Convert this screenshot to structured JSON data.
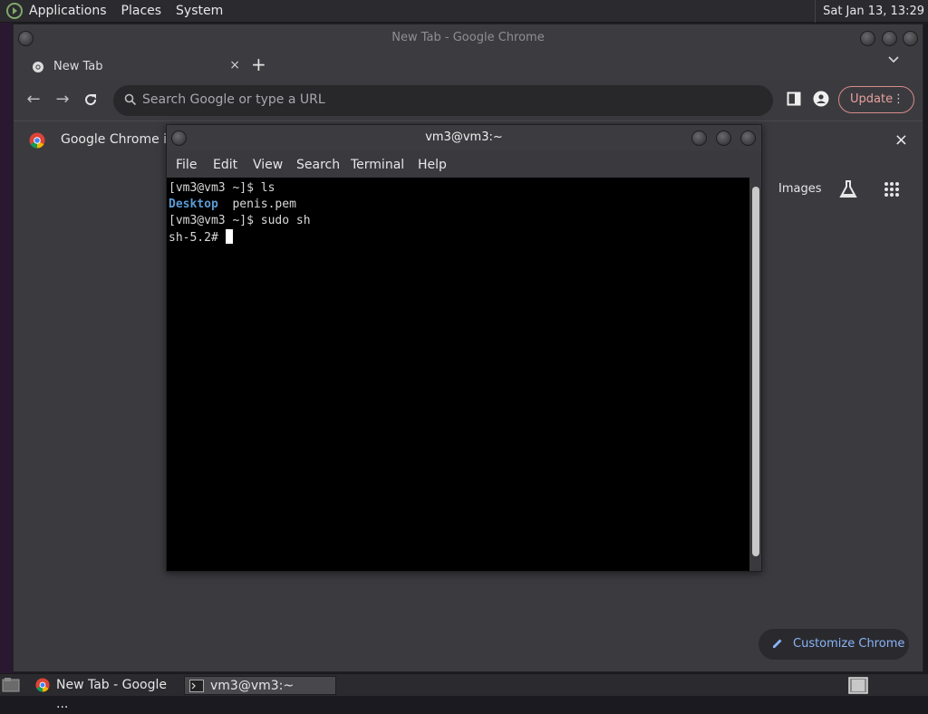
{
  "top_panel": {
    "menus": [
      "Applications",
      "Places",
      "System"
    ],
    "clock": "Sat Jan 13, 13:29"
  },
  "chrome": {
    "window_title": "New Tab - Google Chrome",
    "tab": {
      "title": "New Tab",
      "close": "×"
    },
    "new_tab": "+",
    "omnibox_placeholder": "Search Google or type a URL",
    "update_label": "Update",
    "update_menu": "⋮",
    "info_bar_text": "Google Chrome isn",
    "info_close": "×",
    "ntp": {
      "images_link": "Images",
      "customize_label": "Customize Chrome"
    }
  },
  "terminal": {
    "title": "vm3@vm3:~",
    "menus": [
      "File",
      "Edit",
      "View",
      "Search",
      "Terminal",
      "Help"
    ],
    "lines": {
      "l1": "[vm3@vm3 ~]$ ls",
      "l2_dir": "Desktop",
      "l2_file": "  penis.pem",
      "l3": "[vm3@vm3 ~]$ sudo sh",
      "l4": "sh-5.2# "
    }
  },
  "taskbar": {
    "items": [
      "New Tab - Google ...",
      "vm3@vm3:~"
    ]
  },
  "colors": {
    "accent_blue": "#8ab4f8",
    "update_red": "#e8a0a0",
    "dir_blue": "#5b9bd5"
  }
}
